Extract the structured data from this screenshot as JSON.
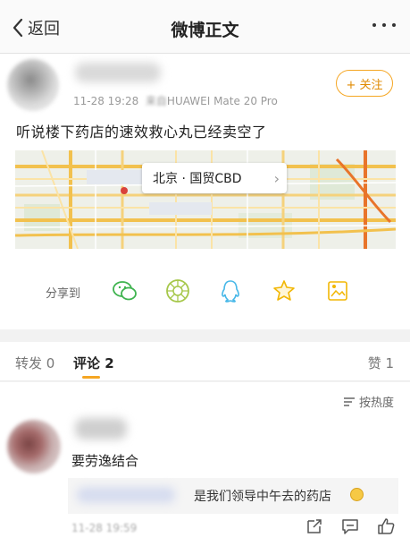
{
  "nav": {
    "back_label": "返回",
    "title": "微博正文"
  },
  "post": {
    "time": "11-28 19:28",
    "source_prefix": "来自",
    "device": "HUAWEI Mate 20 Pro",
    "follow_label": "+ 关注",
    "text": "听说楼下药店的速效救心丸已经卖空了",
    "location": "北京 · 国贸CBD"
  },
  "share": {
    "label": "分享到",
    "icons": [
      "wechat-icon",
      "moments-icon",
      "qq-icon",
      "qzone-icon",
      "save-image-icon"
    ]
  },
  "tabs": [
    {
      "label": "转发 0"
    },
    {
      "label": "评论 2",
      "active": true
    },
    {
      "label": "赞 1"
    }
  ],
  "comments": {
    "sort_label": "按热度",
    "items": [
      {
        "text": "要劳逸结合",
        "reply": {
          "text": "是我们领导中午去的药店"
        },
        "time": "11-28 19:59"
      }
    ]
  },
  "colors": {
    "accent": "#f5a623",
    "wechat": "#3fb34f",
    "qq": "#48b8e8"
  }
}
